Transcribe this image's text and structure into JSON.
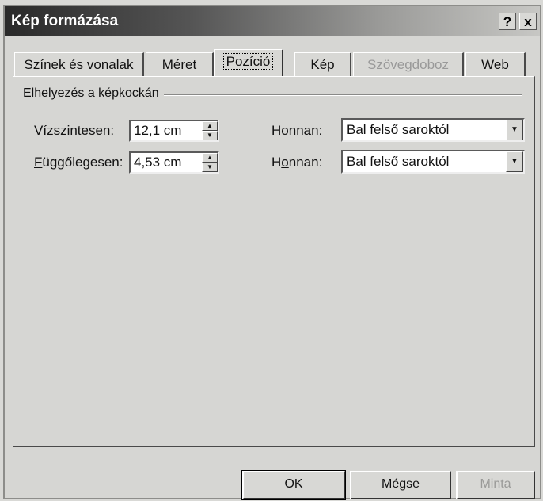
{
  "window": {
    "title": "Kép formázása",
    "help_label": "?",
    "close_label": "x"
  },
  "tabs": [
    {
      "label": "Színek és vonalak",
      "state": "normal"
    },
    {
      "label": "Méret",
      "state": "normal"
    },
    {
      "label": "Pozíció",
      "state": "active"
    },
    {
      "label": "Kép",
      "state": "normal"
    },
    {
      "label": "Szövegdoboz",
      "state": "disabled"
    },
    {
      "label": "Web",
      "state": "normal"
    }
  ],
  "group": {
    "label": "Elhelyezés a képkockán"
  },
  "horizontal": {
    "label_prefix": "",
    "label_u": "V",
    "label_rest": "ízszintesen:",
    "value": "12,1 cm",
    "from_label_u": "H",
    "from_label_rest": "onnan:",
    "from_value": "Bal felső saroktól"
  },
  "vertical": {
    "label_u": "F",
    "label_rest": "üggőlegesen:",
    "value": "4,53 cm",
    "from_label_pre": "H",
    "from_label_u": "o",
    "from_label_rest": "nnan:",
    "from_value": "Bal felső saroktól"
  },
  "buttons": {
    "ok": "OK",
    "cancel": "Mégse",
    "preview": "Minta"
  }
}
